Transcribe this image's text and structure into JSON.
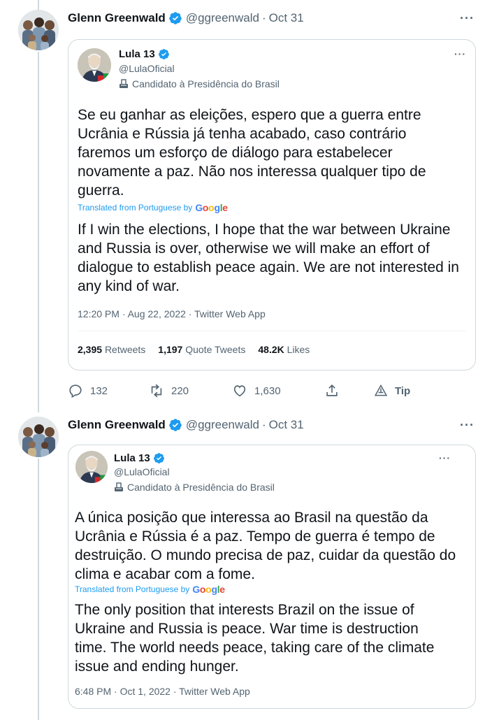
{
  "tweets": [
    {
      "author": {
        "name": "Glenn Greenwald",
        "handle": "@ggreenwald",
        "separator": "·",
        "date": "Oct 31"
      },
      "more": "···",
      "quote": {
        "name": "Lula 13",
        "handle": "@LulaOficial",
        "label": "Candidato à Presidência do Brasil",
        "more": "···",
        "original_text": "Se eu ganhar as eleições, espero que a guerra entre Ucrânia e Rússia já tenha acabado, caso contrário faremos um esforço de diálogo para estabelecer novamente a paz. Não nos interessa qualquer tipo de guerra.",
        "translated_label": "Translated from Portuguese by",
        "translated_text": "If I win the elections, I hope that the war between Ukraine and Russia is over, otherwise we will make an effort of dialogue to establish peace again. We are not interested in any kind of war.",
        "meta": "12:20 PM · Aug 22, 2022 · Twitter Web App",
        "stats": {
          "retweets_count": "2,395",
          "retweets_label": "Retweets",
          "quotes_count": "1,197",
          "quotes_label": "Quote Tweets",
          "likes_count": "48.2K",
          "likes_label": "Likes"
        }
      },
      "actions": {
        "replies": "132",
        "retweets": "220",
        "likes": "1,630",
        "tip": "Tip"
      }
    },
    {
      "author": {
        "name": "Glenn Greenwald",
        "handle": "@ggreenwald",
        "separator": "·",
        "date": "Oct 31"
      },
      "more": "···",
      "quote": {
        "name": "Lula 13",
        "handle": "@LulaOficial",
        "label": "Candidato à Presidência do Brasil",
        "more": "···",
        "original_text": "A única posição que interessa ao Brasil na questão da Ucrânia e Rússia é a paz. Tempo de guerra é tempo de destruição. O mundo precisa de paz, cuidar da questão do clima e acabar com a fome.",
        "translated_label": "Translated from Portuguese by",
        "translated_text": "The only position that interests Brazil on the issue of Ukraine and Russia is peace. War time is destruction time. The world needs peace, taking care of the climate issue and ending hunger.",
        "meta": "6:48 PM · Oct 1, 2022 · Twitter Web App"
      }
    }
  ],
  "google_logo": {
    "G": "G",
    "o1": "o",
    "o2": "o",
    "g": "g",
    "l": "l",
    "e": "e"
  },
  "colors": {
    "verified": "#1d9bf0",
    "link": "#1d9bf0",
    "muted": "#536471",
    "border": "#cfd9de"
  }
}
